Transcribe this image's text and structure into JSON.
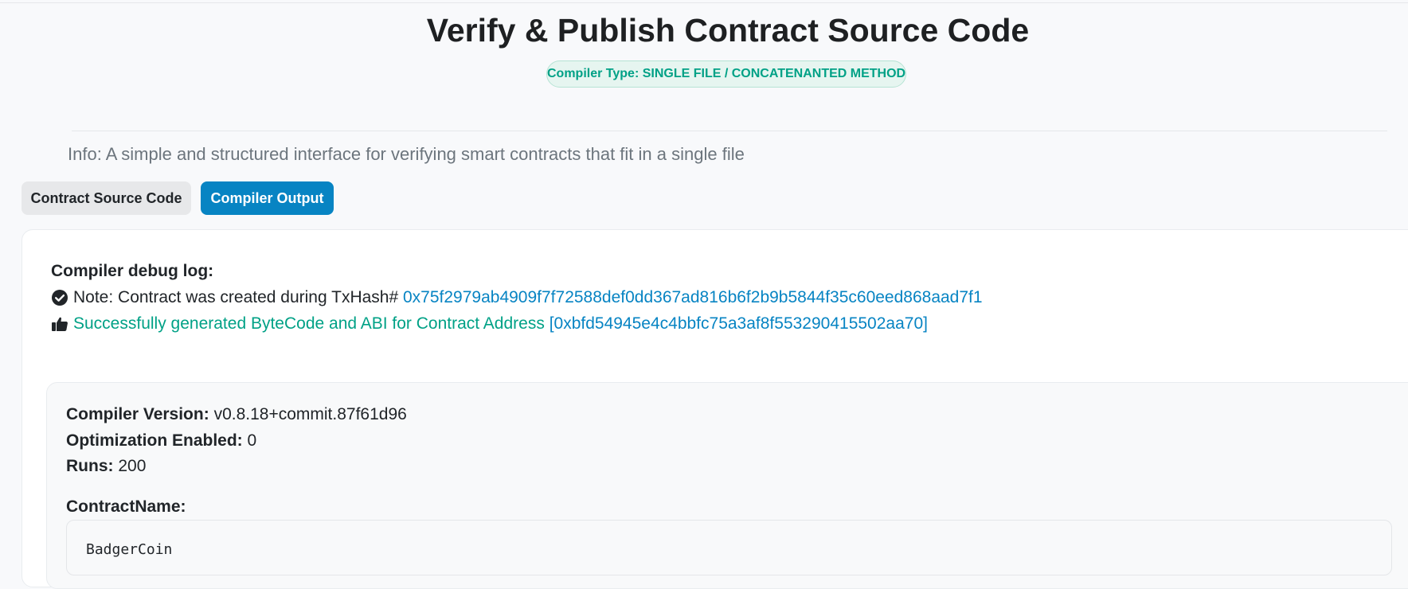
{
  "header": {
    "title": "Verify & Publish Contract Source Code",
    "compiler_type_badge": "Compiler Type: SINGLE FILE / CONCATENANTED METHOD"
  },
  "info": {
    "text": "Info: A simple and structured interface for verifying smart contracts that fit in a single file"
  },
  "tabs": [
    {
      "label": "Contract Source Code",
      "active": false
    },
    {
      "label": "Compiler Output",
      "active": true
    }
  ],
  "debug_log": {
    "title": "Compiler debug log:",
    "note_prefix": "Note: Contract was created during TxHash#",
    "tx_hash": "0x75f2979ab4909f7f72588def0dd367ad816b6f2b9b5844f35c60eed868aad7f1",
    "success_text": "Successfully generated ByteCode and ABI for Contract Address",
    "contract_address": "[0xbfd54945e4c4bbfc75a3af8f553290415502aa70]",
    "icons": [
      "check-circle-icon",
      "thumbs-up-icon"
    ]
  },
  "compiler_info": {
    "version_label": "Compiler Version:",
    "version_value": "v0.8.18+commit.87f61d96",
    "optimization_label": "Optimization Enabled:",
    "optimization_value": "0",
    "runs_label": "Runs:",
    "runs_value": "200",
    "contract_name_label": "ContractName:",
    "contract_name_value": "BadgerCoin"
  },
  "colors": {
    "primary": "#0784c3",
    "success": "#00a186",
    "muted": "#6c757d"
  }
}
